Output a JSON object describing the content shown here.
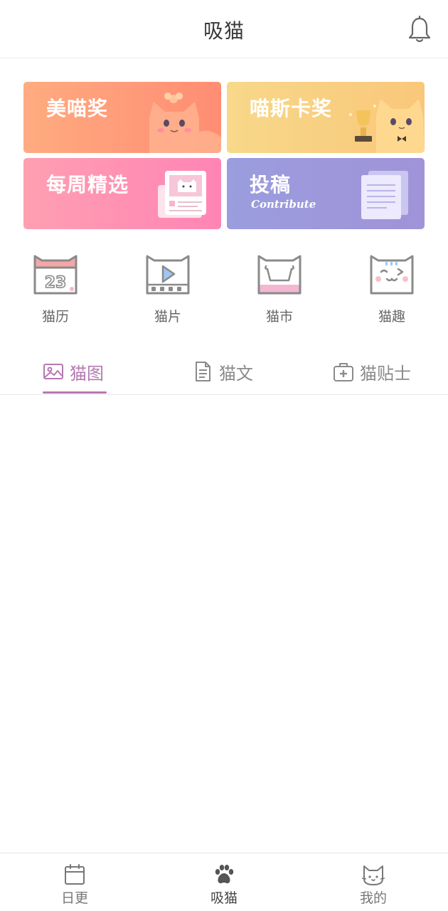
{
  "header": {
    "title": "吸猫"
  },
  "banners": [
    {
      "label": "美喵奖"
    },
    {
      "label": "喵斯卡奖"
    },
    {
      "label": "每周精选"
    },
    {
      "label": "投稿",
      "sublabel": "Contribute"
    }
  ],
  "quick": [
    {
      "label": "猫历",
      "icon": "calendar-cat-icon",
      "date_number": "23"
    },
    {
      "label": "猫片",
      "icon": "video-cat-icon"
    },
    {
      "label": "猫市",
      "icon": "shop-cat-icon"
    },
    {
      "label": "猫趣",
      "icon": "fun-cat-icon"
    }
  ],
  "tabs": [
    {
      "label": "猫图",
      "icon": "image-icon",
      "active": true
    },
    {
      "label": "猫文",
      "icon": "document-icon",
      "active": false
    },
    {
      "label": "猫贴士",
      "icon": "first-aid-kit-icon",
      "active": false
    }
  ],
  "bottom_nav": [
    {
      "label": "日更",
      "icon": "calendar-icon",
      "active": false
    },
    {
      "label": "吸猫",
      "icon": "paw-icon",
      "active": true
    },
    {
      "label": "我的",
      "icon": "cat-face-icon",
      "active": false
    }
  ],
  "colors": {
    "accent": "#b479b0",
    "banner_orange": "#ff9a78",
    "banner_yellow": "#f8cf80",
    "banner_pink": "#ff90b3",
    "banner_purple": "#9e98db"
  }
}
